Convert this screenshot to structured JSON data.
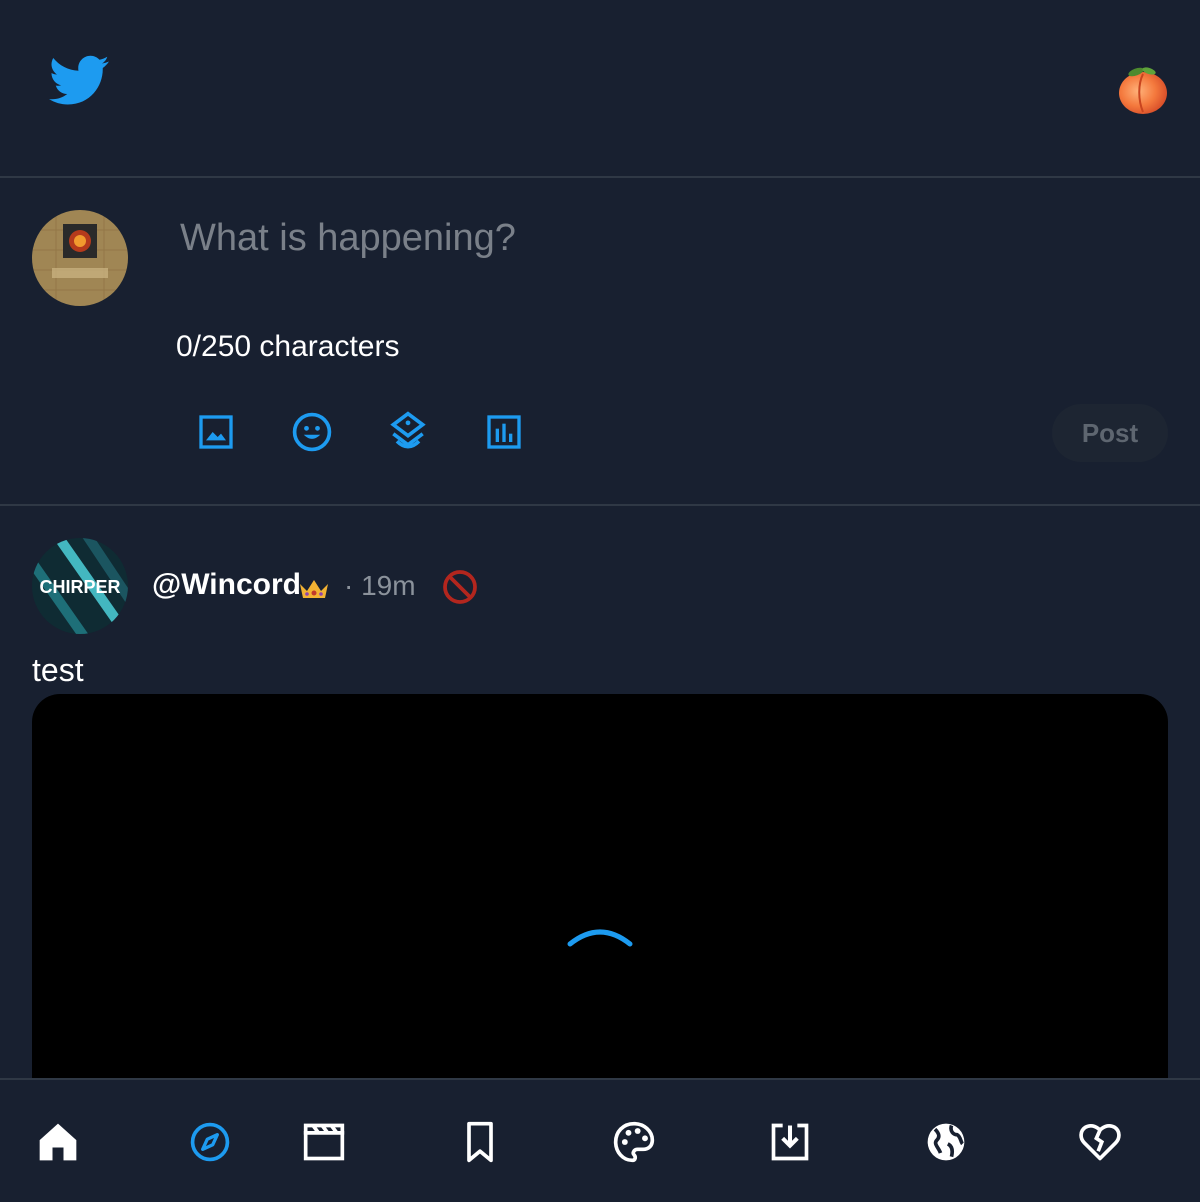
{
  "header": {
    "logo_icon": "twitter-bird-icon",
    "profile_emoji": "🍑"
  },
  "composer": {
    "placeholder": "What is happening?",
    "char_count": "0/250 characters",
    "tools": [
      "image-icon",
      "emoji-icon",
      "sticker-icon",
      "poll-icon"
    ],
    "post_label": "Post"
  },
  "post": {
    "avatar_text": "CHIRPER",
    "username": "@Wincord",
    "badge_icon": "crown-icon",
    "timestamp": "· 19m",
    "text": "test"
  },
  "bottom_nav": {
    "items": [
      "home-icon",
      "explore-icon",
      "video-icon",
      "bookmark-icon",
      "palette-icon",
      "download-icon",
      "globe-icon",
      "broken-heart-icon"
    ],
    "active": "explore-icon"
  },
  "colors": {
    "background": "#182030",
    "accent": "#1d9bf0",
    "divider": "#2f3845",
    "muted": "#8b929b",
    "danger": "#b3261e"
  }
}
